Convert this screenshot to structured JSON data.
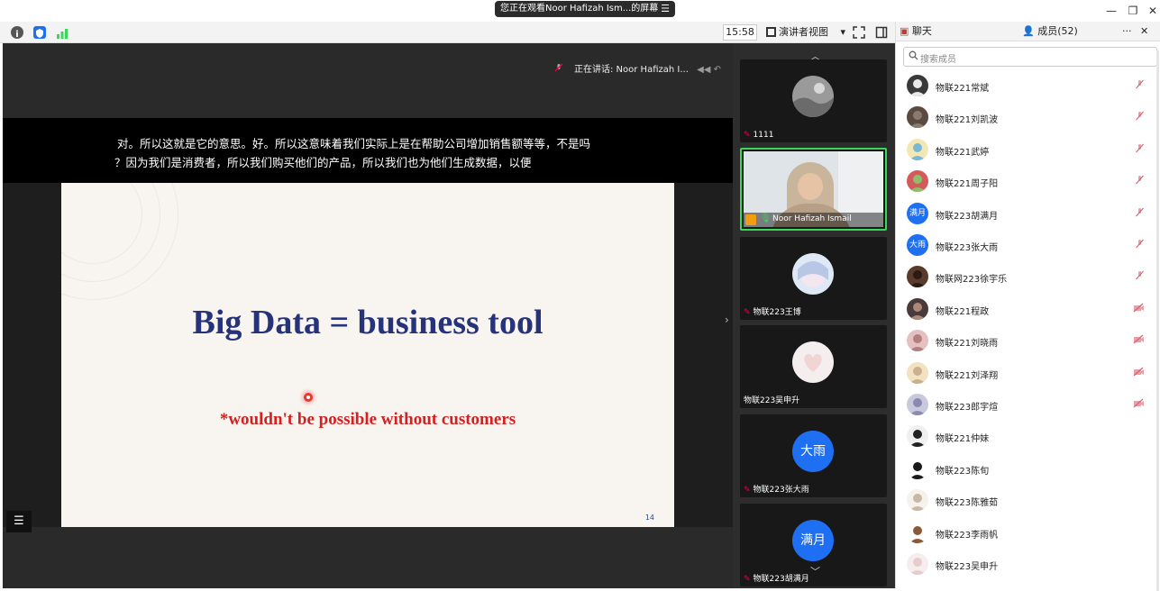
{
  "titlebar": {
    "sharing_text": "您正在观看Noor Hafizah Ism...的屏幕",
    "menu_glyph": "☰",
    "minimize": "—",
    "restore": "❐",
    "close": "✕"
  },
  "toolbar": {
    "timer": "15:58",
    "view_label": "演讲者视图",
    "view_arrow": "▾"
  },
  "stage": {
    "speaking_label": "正在讲话: Noor Hafizah I...",
    "captions": [
      "对。所以这就是它的意思。好。所以这意味着我们实际上是在帮助公司增加销售额等等，不是吗",
      "？因为我们是消费者，所以我们购买他们的产品，所以我们也为他们生成数据，以便"
    ],
    "slide": {
      "title": "Big Data = business tool",
      "subtitle": "*wouldn't be possible without customers",
      "page_number": "14"
    },
    "list_glyph": "☰",
    "collapse_glyph": "›"
  },
  "videos": [
    {
      "name": "1111",
      "type": "avatar",
      "muted": true
    },
    {
      "name": "Noor Hafizah Ismail",
      "type": "camera",
      "muted": false,
      "active": true
    },
    {
      "name": "物联223王博",
      "type": "avatar",
      "muted": true
    },
    {
      "name": "物联223吴申升",
      "type": "avatar",
      "muted": false
    },
    {
      "name": "物联223张大雨",
      "type": "initials",
      "initials": "大雨",
      "muted": true
    },
    {
      "name": "物联223胡满月",
      "type": "initials",
      "initials": "满月",
      "muted": true
    }
  ],
  "side": {
    "chat_tab": "聊天",
    "members_tab": "成员(52)",
    "more": "···",
    "close": "✕",
    "search_placeholder": "搜索成员",
    "members": [
      {
        "name": "物联221常斌",
        "status": "mic-off"
      },
      {
        "name": "物联221刘凯波",
        "status": "mic-off"
      },
      {
        "name": "物联221武婷",
        "status": "mic-off"
      },
      {
        "name": "物联221周子阳",
        "status": "mic-off"
      },
      {
        "name": "物联223胡满月",
        "status": "mic-off",
        "initials": "满月"
      },
      {
        "name": "物联223张大雨",
        "status": "mic-off",
        "initials": "大雨"
      },
      {
        "name": "物联网223徐宇乐",
        "status": "mic-off"
      },
      {
        "name": "物联221程政",
        "status": "cam-off"
      },
      {
        "name": "物联221刘晓雨",
        "status": "cam-off"
      },
      {
        "name": "物联221刘泽翔",
        "status": "cam-off"
      },
      {
        "name": "物联223郎宇煊",
        "status": "cam-off"
      },
      {
        "name": "物联221仲妹",
        "status": "none"
      },
      {
        "name": "物联223陈旬",
        "status": "none"
      },
      {
        "name": "物联223陈雅茹",
        "status": "none"
      },
      {
        "name": "物联223李雨帆",
        "status": "none"
      },
      {
        "name": "物联223吴申升",
        "status": "none"
      }
    ]
  },
  "colors": {
    "slide_title": "#26337a",
    "slide_sub": "#d52020",
    "active_border": "#3bd65a",
    "avatar_blue": "#1f6ff2"
  }
}
